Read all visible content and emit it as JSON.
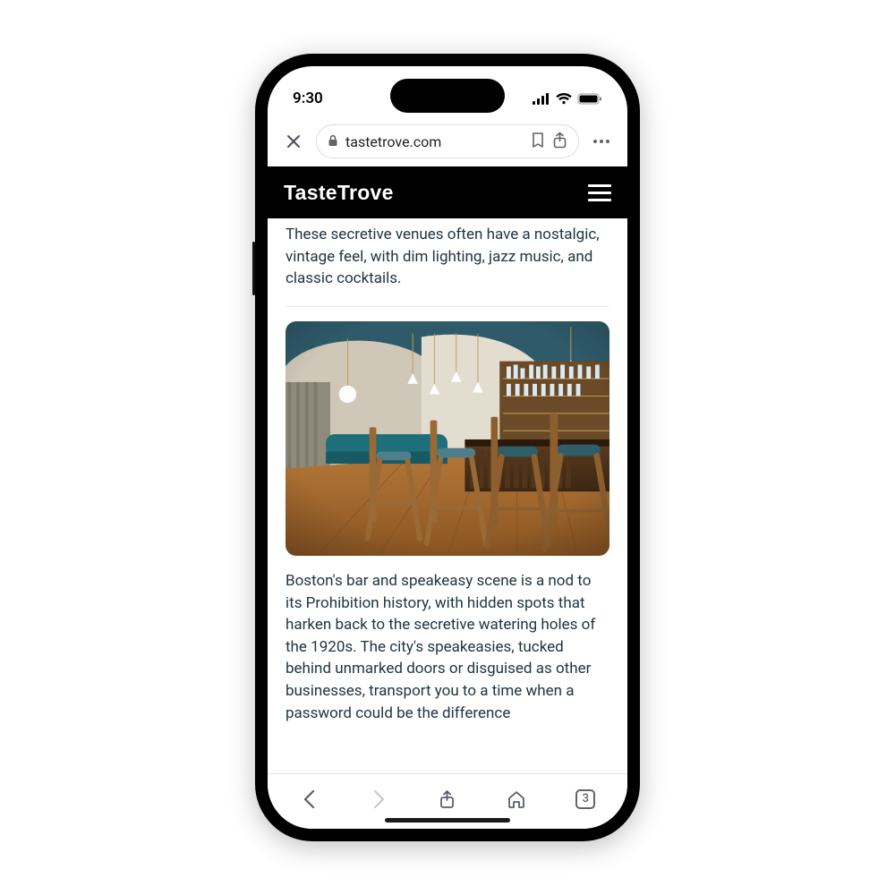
{
  "status": {
    "time": "9:30"
  },
  "browser": {
    "domain": "tastetrove.com",
    "tabs_count": "3"
  },
  "site": {
    "brand": "TasteTrove"
  },
  "article": {
    "lead_partial": "These secretive venues often have a nostalgic, vintage feel, with dim lighting, jazz music, and classic cocktails.",
    "body1": "Boston's bar and speakeasy scene is a nod to its Prohibition history, with hidden spots that harken back to the secretive watering holes of the 1920s. The city's speakeasies, tucked behind unmarked doors or disguised as other businesses, transport you to a time when a password could be the difference"
  }
}
